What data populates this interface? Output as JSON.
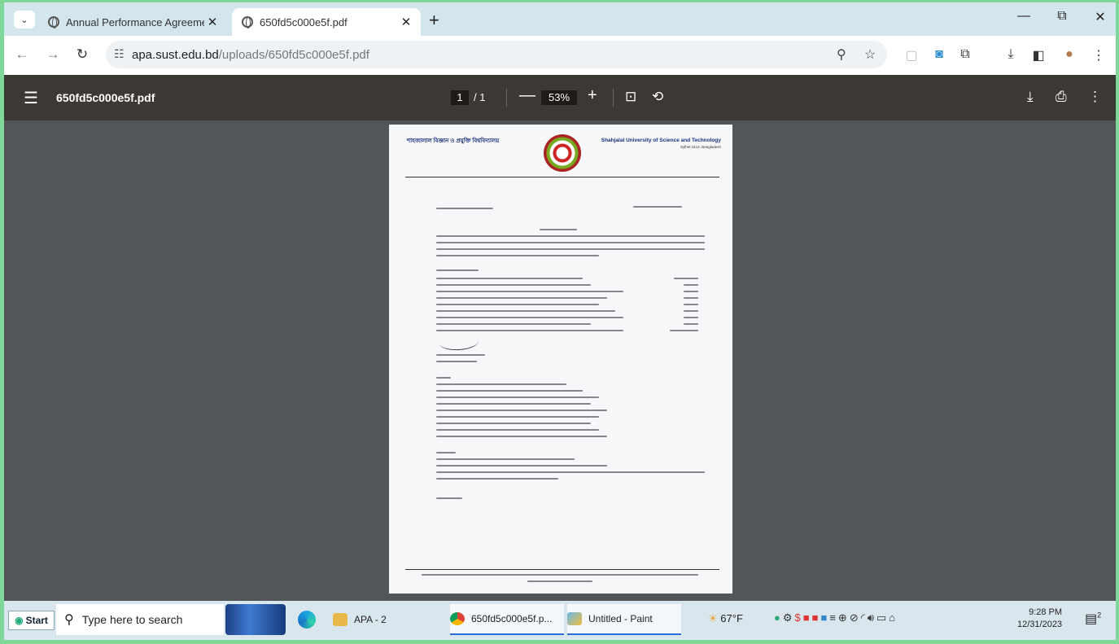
{
  "browser": {
    "tabs": [
      {
        "title": "Annual Performance Agreeme",
        "close": "✕",
        "active": false
      },
      {
        "title": "650fd5c000e5f.pdf",
        "close": "✕",
        "active": true
      }
    ],
    "new_tab": "+",
    "window_controls": {
      "minimize": "—",
      "restore": "⧉",
      "close": "✕"
    },
    "url": {
      "domain": "apa.sust.edu.bd",
      "path": "/uploads/650fd5c000e5f.pdf"
    }
  },
  "pdf_viewer": {
    "filename": "650fd5c000e5f.pdf",
    "current_page": "1",
    "total_pages": "/ 1",
    "zoom": "53%",
    "zoom_out": "—",
    "zoom_in": "+"
  },
  "document": {
    "header_bangla": "শাহজালাল বিজ্ঞান ও প্রযুক্তি বিশ্ববিদ্যালয়",
    "header_english": "Shahjalal University of Science and Technology",
    "header_english_sub": "Sylhet-3114, Bangladesh"
  },
  "taskbar": {
    "start_label": "Start",
    "search_placeholder": "Type here to search",
    "apps": [
      {
        "label": "APA - 2",
        "icon": "folder-icon"
      },
      {
        "label": "650fd5c000e5f.p...",
        "icon": "chrome-icon"
      },
      {
        "label": "Untitled - Paint",
        "icon": "paint-icon"
      }
    ],
    "weather": "67°F",
    "time": "9:28 PM",
    "date": "12/31/2023",
    "notification_count": "2"
  },
  "colors": {
    "tabstrip": "#d3e6ee",
    "pdf_toolbar": "#3c3833",
    "viewer_bg": "#525659",
    "header_blue": "#1a2f7a"
  }
}
